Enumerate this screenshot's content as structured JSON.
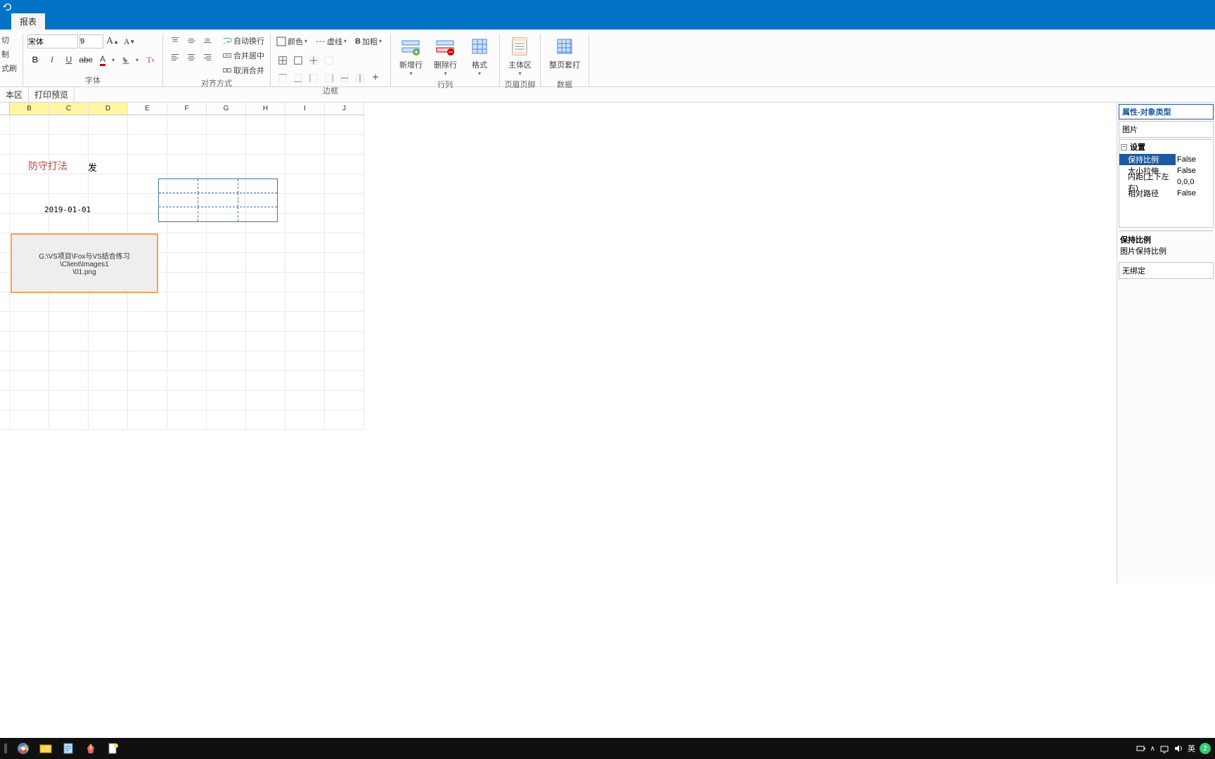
{
  "titlebar": {},
  "tabs": {
    "main": "报表"
  },
  "ribbon": {
    "clipboard": {
      "cut_label": "切",
      "copy_label": "制",
      "brush_label": "式刷"
    },
    "font": {
      "label": "字体",
      "font_name": "宋体",
      "font_size": "9",
      "increase_tip": "A",
      "decrease_tip": "A"
    },
    "align": {
      "label": "对齐方式",
      "wrap_label": "自动换行",
      "merge_center_label": "合并居中",
      "unmerge_label": "取消合并"
    },
    "border": {
      "label": "边框",
      "color_label": "颜色",
      "dash_label": "虚线",
      "bold_label": "加粗"
    },
    "rows": {
      "label": "行列",
      "add_row": "新增行",
      "del_row": "删除行",
      "format": "格式"
    },
    "header_footer": {
      "label": "页眉页脚",
      "main_area": "主体区"
    },
    "data": {
      "label": "数据",
      "page_print": "整页套打"
    }
  },
  "subtabs": {
    "left_stub": "本区",
    "print_preview": "打印预览"
  },
  "columns": [
    "B",
    "C",
    "D",
    "E",
    "F",
    "G",
    "H",
    "I",
    "J"
  ],
  "selected_cols": [
    "B",
    "C",
    "D"
  ],
  "sheet": {
    "cellA": "防守打法",
    "cellB": "发",
    "date_text": "2019-01-01",
    "image_path_line1": "G:\\VS项目\\Fox与VS结合练习\\Client\\Images1",
    "image_path_line2": "\\01.png"
  },
  "properties": {
    "panel_title": "属性-对象类型",
    "object_type": "图片",
    "category": "设置",
    "rows": [
      {
        "key": "保持比例",
        "val": "False",
        "selected": true
      },
      {
        "key": "大小拉伸",
        "val": "False"
      },
      {
        "key": "内距(上下左右)",
        "val": "0,0,0"
      },
      {
        "key": "相对路径",
        "val": "False"
      }
    ],
    "desc_title": "保持比例",
    "desc_body": "图片保持比例",
    "binding": "无绑定"
  },
  "taskbar": {
    "ime": "英",
    "badge": "2"
  }
}
